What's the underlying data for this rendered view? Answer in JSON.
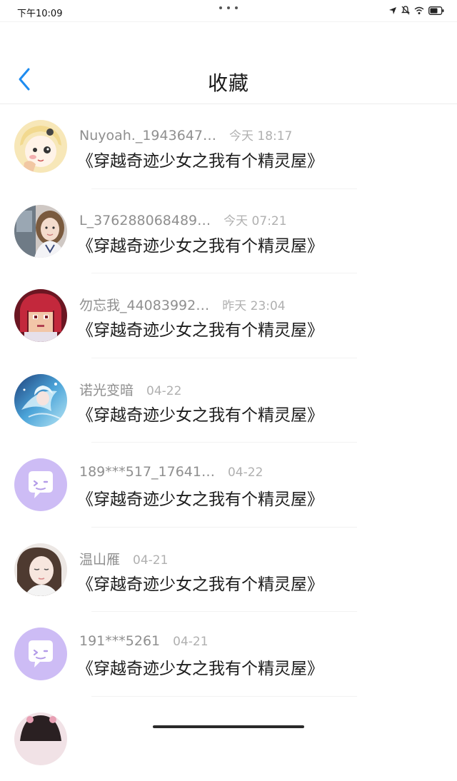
{
  "status_bar": {
    "time": "下午10:09"
  },
  "header": {
    "title": "收藏"
  },
  "items": [
    {
      "name": "Nuyoah._1943647…",
      "time": "今天 18:17",
      "title": "《穿越奇迹少女之我有个精灵屋》",
      "avatar": "anime-girl-avatar"
    },
    {
      "name": "L_376288068489…",
      "time": "今天 07:21",
      "title": "《穿越奇迹少女之我有个精灵屋》",
      "avatar": "photo-avatar"
    },
    {
      "name": "勿忘我_44083992…",
      "time": "昨天 23:04",
      "title": "《穿越奇迹少女之我有个精灵屋》",
      "avatar": "pixel-art-avatar"
    },
    {
      "name": "诺光变暗",
      "time": "04-22",
      "title": "《穿越奇迹少女之我有个精灵屋》",
      "avatar": "blue-anime-avatar"
    },
    {
      "name": "189***517_17641…",
      "time": "04-22",
      "title": "《穿越奇迹少女之我有个精灵屋》",
      "avatar": "default-chat-avatar"
    },
    {
      "name": "温山雁",
      "time": "04-21",
      "title": "《穿越奇迹少女之我有个精灵屋》",
      "avatar": "photo-avatar"
    },
    {
      "name": "191***5261",
      "time": "04-21",
      "title": "《穿越奇迹少女之我有个精灵屋》",
      "avatar": "default-chat-avatar"
    },
    {
      "name": "",
      "time": "",
      "title": "",
      "avatar": "partial-avatar"
    }
  ],
  "colors": {
    "accent": "#1e8cf0",
    "default_avatar_bg": "#cdbcf5"
  }
}
